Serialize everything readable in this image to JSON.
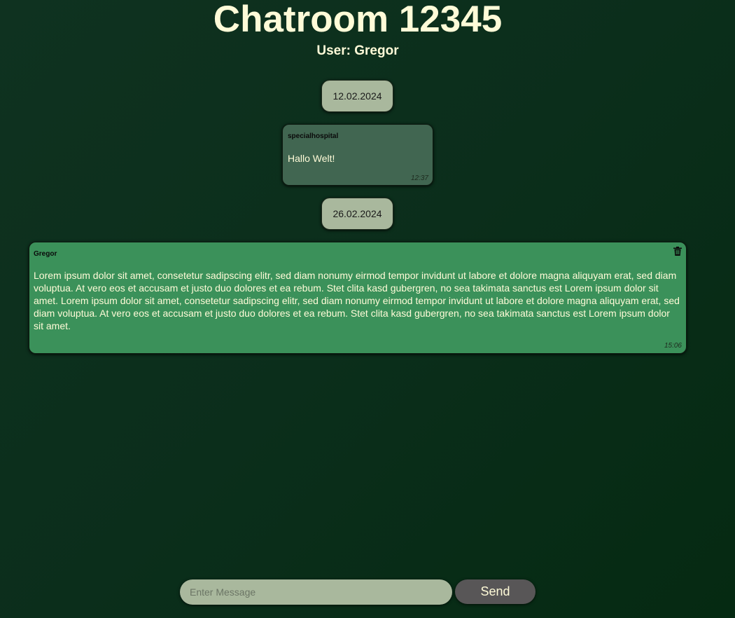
{
  "header": {
    "title": "Chatroom 12345",
    "user_line": "User: Gregor"
  },
  "conversation": [
    {
      "date": "12.02.2024",
      "messages": [
        {
          "author": "specialhospital",
          "text": "Hallo Welt!",
          "time": "12:37",
          "own": false
        }
      ]
    },
    {
      "date": "26.02.2024",
      "messages": [
        {
          "author": "Gregor",
          "text": "Lorem ipsum dolor sit amet, consetetur sadipscing elitr, sed diam nonumy eirmod tempor invidunt ut labore et dolore magna aliquyam erat, sed diam voluptua. At vero eos et accusam et justo duo dolores et ea rebum. Stet clita kasd gubergren, no sea takimata sanctus est Lorem ipsum dolor sit amet. Lorem ipsum dolor sit amet, consetetur sadipscing elitr, sed diam nonumy eirmod tempor invidunt ut labore et dolore magna aliquyam erat, sed diam voluptua. At vero eos et accusam et justo duo dolores et ea rebum. Stet clita kasd gubergren, no sea takimata sanctus est Lorem ipsum dolor sit amet.",
          "time": "15:06",
          "own": true,
          "delete_icon": "trash-icon"
        }
      ]
    }
  ],
  "composer": {
    "placeholder": "Enter Message",
    "value": "",
    "send_label": "Send"
  },
  "colors": {
    "background": "#0b2e1b",
    "title_text": "#fffbd8",
    "date_pill": "#a9b89d",
    "other_message": "#416651",
    "own_message": "#3b915a",
    "send_button": "#585657"
  }
}
